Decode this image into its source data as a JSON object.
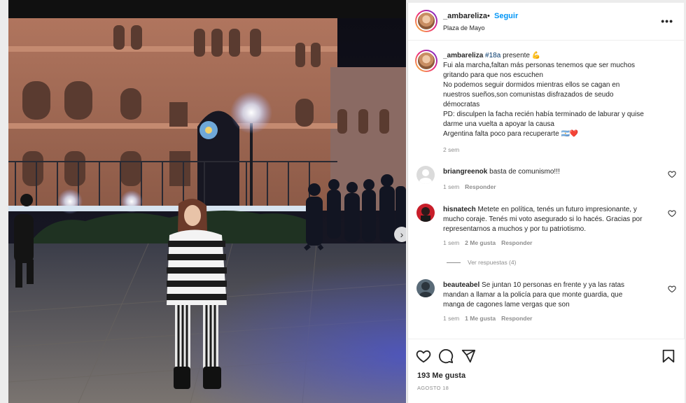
{
  "header": {
    "username": "_ambareliza",
    "separator": "•",
    "follow_label": "Seguir",
    "location": "Plaza de Mayo",
    "more_label": "•••"
  },
  "photo": {
    "next_label": "›"
  },
  "caption": {
    "username": "_ambareliza",
    "hashtag": "#18a",
    "first_text": " presente 💪",
    "lines": [
      "Fui ala marcha,faltan más personas tenemos que ser muchos",
      "gritando para que nos escuchen",
      "No podemos seguir dormidos mientras ellos se cagan en",
      "nuestros sueños,son comunistas disfrazados de seudo",
      "démocratas",
      "PD: disculpen la facha recién había terminado de laburar y quise",
      "darme una vuelta a apoyar la causa",
      "Argentina falta poco para recuperarte 🇦🇷❤️"
    ],
    "time": "2 sem"
  },
  "comments": [
    {
      "username": "briangreenok",
      "lines": [
        "basta de comunismo!!!"
      ],
      "time": "1 sem",
      "likes": "",
      "reply_label": "Responder"
    },
    {
      "username": "hisnatech",
      "lines": [
        "Metete en política, tenés un futuro impresionante, y",
        "mucho coraje. Tenés mi voto asegurado si lo hacés. Gracias por",
        "representarnos a muchos y por tu patriotismo."
      ],
      "time": "1 sem",
      "likes": "2 Me gusta",
      "reply_label": "Responder",
      "replies_label": "Ver respuestas (4)"
    },
    {
      "username": "beauteabel",
      "lines": [
        "Se juntan 10 personas en frente y ya las ratas",
        "mandan a llamar a la policía para que monte guardia, que",
        "manga de cagones lame vergas que son"
      ],
      "time": "1 sem",
      "likes": "1 Me gusta",
      "reply_label": "Responder"
    }
  ],
  "footer": {
    "likes": "193 Me gusta",
    "date": "AGOSTO 18"
  },
  "colors": {
    "link_blue": "#0095f6",
    "text": "#262626",
    "muted": "#8e8e8e"
  }
}
